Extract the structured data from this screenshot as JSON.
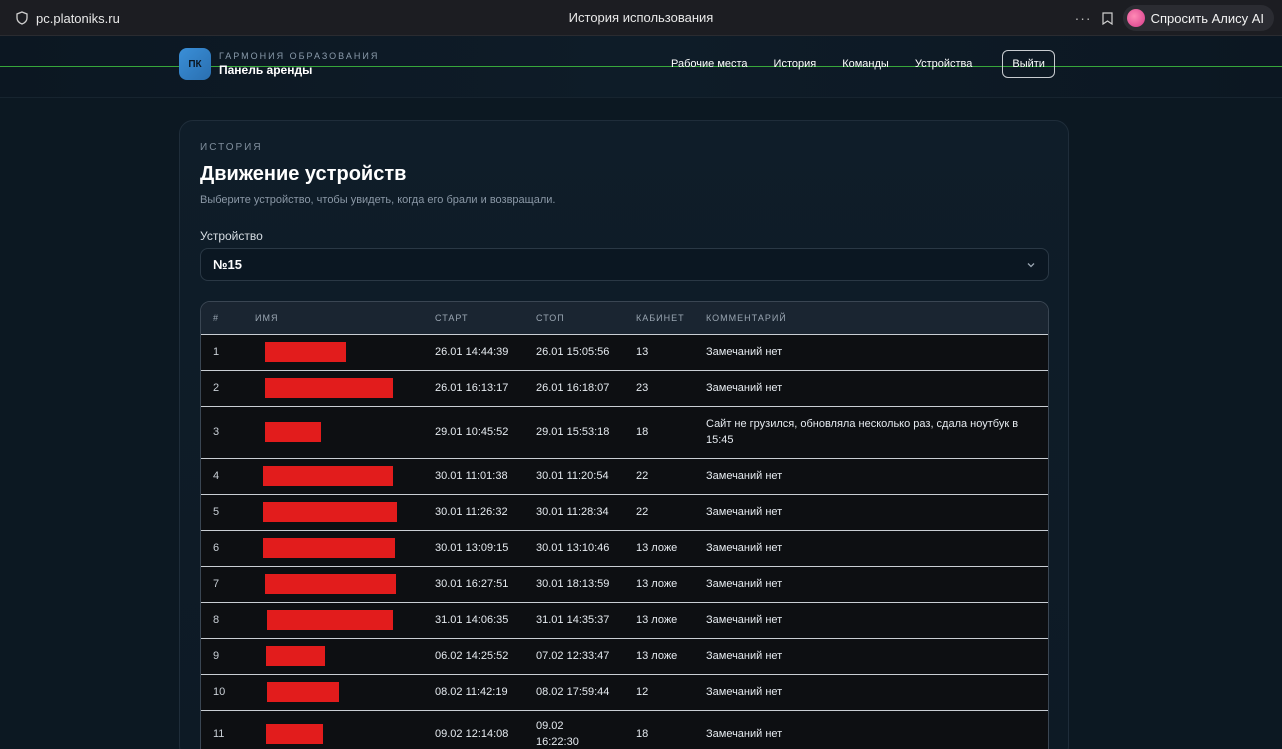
{
  "browser": {
    "url": "pc.platoniks.ru",
    "tab_title": "История использования",
    "more_icon": "···",
    "alice_label": "Спросить Алису AI"
  },
  "header": {
    "logo_text": "ПК",
    "brand_subtitle": "ГАРМОНИЯ ОБРАЗОВАНИЯ",
    "brand_title": "Панель аренды",
    "nav": [
      "Рабочие места",
      "История",
      "Команды",
      "Устройства"
    ],
    "logout_label": "Выйти"
  },
  "main": {
    "eyebrow": "ИСТОРИЯ",
    "title": "Движение устройств",
    "subtitle": "Выберите устройство, чтобы увидеть, когда его брали и возвращали.",
    "device_label": "Устройство",
    "device_value": "№15",
    "table": {
      "columns": [
        "#",
        "ИМЯ",
        "СТАРТ",
        "СТОП",
        "КАБИНЕТ",
        "КОММЕНТАРИЙ"
      ],
      "rows": [
        {
          "n": "1",
          "start": "26.01 14:44:39",
          "stop": "26.01 15:05:56",
          "room": "13",
          "comment": "Замечаний нет"
        },
        {
          "n": "2",
          "start": "26.01 16:13:17",
          "stop": "26.01 16:18:07",
          "room": "23",
          "comment": "Замечаний нет"
        },
        {
          "n": "3",
          "start": "29.01 10:45:52",
          "stop": "29.01 15:53:18",
          "room": "18",
          "comment": "Сайт не грузился, обновляла несколько раз, сдала ноутбук в 15:45"
        },
        {
          "n": "4",
          "start": "30.01 11:01:38",
          "stop": "30.01 11:20:54",
          "room": "22",
          "comment": "Замечаний нет"
        },
        {
          "n": "5",
          "start": "30.01 11:26:32",
          "stop": "30.01 11:28:34",
          "room": "22",
          "comment": "Замечаний нет"
        },
        {
          "n": "6",
          "start": "30.01 13:09:15",
          "stop": "30.01 13:10:46",
          "room": "13 ложе",
          "comment": "Замечаний нет"
        },
        {
          "n": "7",
          "start": "30.01 16:27:51",
          "stop": "30.01 18:13:59",
          "room": "13 ложе",
          "comment": "Замечаний нет"
        },
        {
          "n": "8",
          "start": "31.01 14:06:35",
          "stop": "31.01 14:35:37",
          "room": "13 ложе",
          "comment": "Замечаний нет"
        },
        {
          "n": "9",
          "start": "06.02 14:25:52",
          "stop": "07.02 12:33:47",
          "room": "13 ложе",
          "comment": "Замечаний нет"
        },
        {
          "n": "10",
          "start": "08.02 11:42:19",
          "stop": "08.02 17:59:44",
          "room": "12",
          "comment": "Замечаний нет"
        },
        {
          "n": "11",
          "start": "09.02 12:14:08",
          "stop": "09.02 16:22:30",
          "room": "18",
          "comment": "Замечаний нет"
        }
      ]
    }
  },
  "colors": {
    "accent_blue": "#3a8fd8",
    "redaction": "#e21c1c",
    "background": "#0c1822"
  },
  "icons": {
    "url": "shield-icon",
    "bookmark": "bookmark-icon",
    "alice": "alice-icon",
    "select": "chevron-down-icon"
  }
}
